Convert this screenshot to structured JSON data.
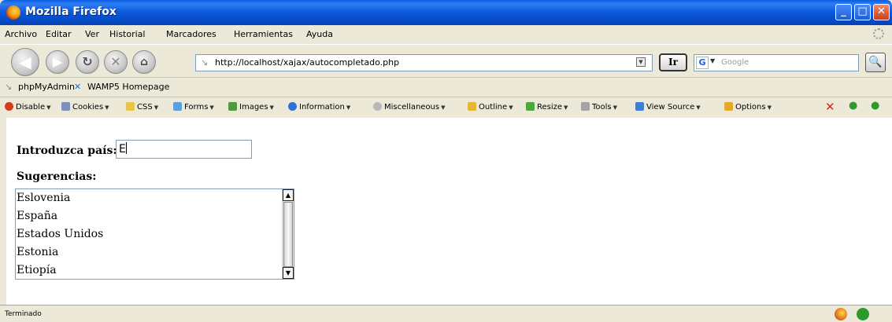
{
  "window": {
    "title": "Mozilla Firefox"
  },
  "menu": [
    "Archivo",
    "Editar",
    "Ver",
    "Historial",
    "Marcadores",
    "Herramientas",
    "Ayuda"
  ],
  "nav": {
    "url": "http://localhost/xajax/autocompletado.php",
    "go_label": "Ir",
    "search_engine_letter": "G",
    "search_placeholder": "Google"
  },
  "bookmarks": [
    "phpMyAdmin",
    "WAMP5 Homepage"
  ],
  "webdev_toolbar": [
    "Disable",
    "Cookies",
    "CSS",
    "Forms",
    "Images",
    "Information",
    "Miscellaneous",
    "Outline",
    "Resize",
    "Tools",
    "View Source",
    "Options"
  ],
  "page": {
    "country_label": "Introduzca país:",
    "country_value": "E",
    "suggestions_label": "Sugerencias:",
    "suggestions": [
      "Eslovenia",
      "España",
      "Estados Unidos",
      "Estonia",
      "Etiopía"
    ]
  },
  "status": {
    "text": "Terminado"
  }
}
